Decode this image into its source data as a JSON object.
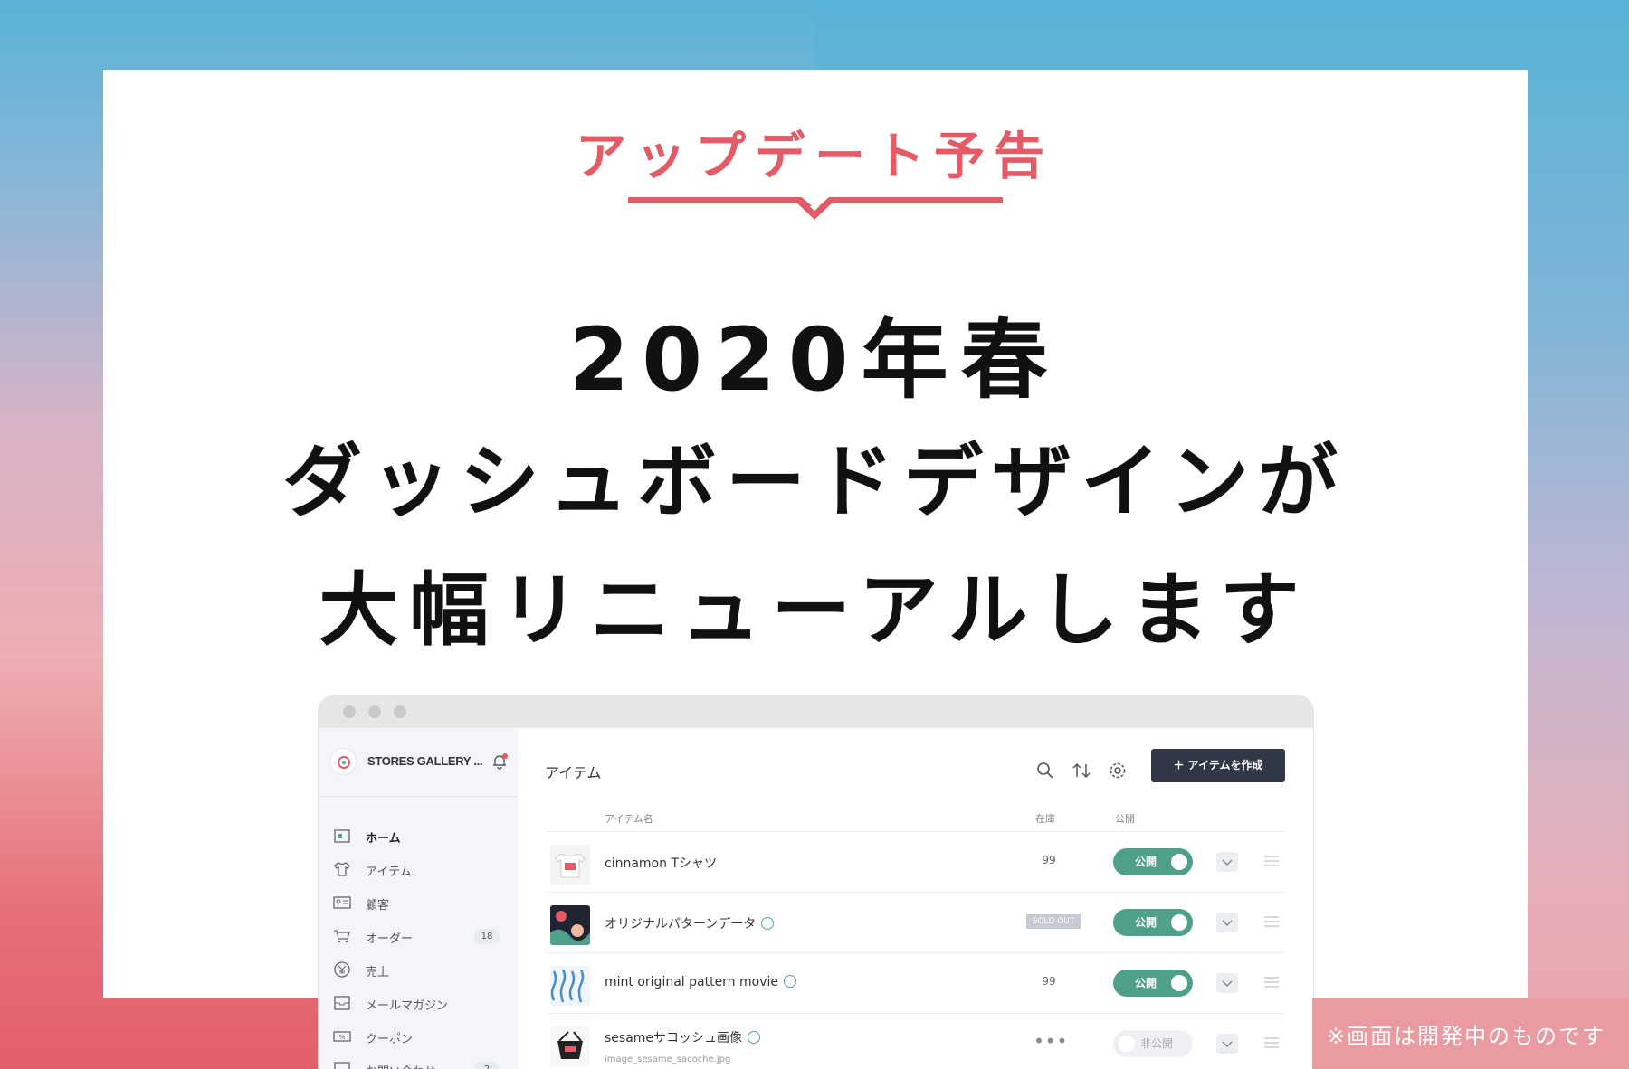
{
  "eyebrow": "アップデート予告",
  "headline": {
    "line1": "2020年春",
    "line2": "ダッシュボードデザインが",
    "line3": "大幅リニューアルします"
  },
  "note": "※画面は開発中のものです",
  "colors": {
    "accent_red": "#e35b66",
    "toggle_green": "#4ea08a",
    "button_dark": "#303847"
  },
  "dashboard": {
    "shop_name": "STORES GALLERY ...",
    "sidebar": {
      "items": [
        {
          "label": "ホーム",
          "icon": "shop-icon",
          "active": true
        },
        {
          "label": "アイテム",
          "icon": "tshirt-icon"
        },
        {
          "label": "顧客",
          "icon": "id-card-icon"
        },
        {
          "label": "オーダー",
          "icon": "cart-icon",
          "badge": "18"
        },
        {
          "label": "売上",
          "icon": "yen-icon"
        },
        {
          "label": "メールマガジン",
          "icon": "mail-icon"
        },
        {
          "label": "クーポン",
          "icon": "coupon-icon"
        },
        {
          "label": "お問い合わせ",
          "icon": "chat-icon",
          "badge": "2"
        }
      ]
    },
    "page_title": "アイテム",
    "create_button": "＋ アイテムを作成",
    "columns": {
      "name": "アイテム名",
      "stock": "在庫",
      "public": "公開"
    },
    "rows": [
      {
        "name": "cinnamon Tシャツ",
        "stock": "99",
        "status": "公開",
        "on": true
      },
      {
        "name": "オリジナルパターンデータ",
        "stock": "SOLD OUT",
        "status": "公開",
        "on": true,
        "digital": true
      },
      {
        "name": "mint original pattern movie",
        "stock": "99",
        "status": "公開",
        "on": true,
        "video": true
      },
      {
        "name": "sesameサコッシュ画像",
        "sub": "image_sesame_sacoche.jpg",
        "stock": "•••",
        "status": "非公開",
        "on": false,
        "image": true
      }
    ]
  }
}
